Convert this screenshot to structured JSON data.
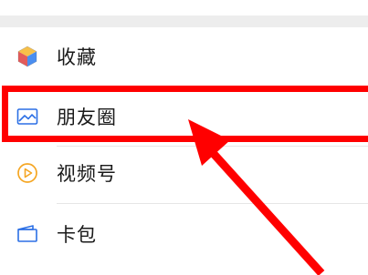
{
  "menu": {
    "items": [
      {
        "label": "收藏",
        "icon": "favorites-cube-icon"
      },
      {
        "label": "朋友圈",
        "icon": "moments-picture-icon"
      },
      {
        "label": "视频号",
        "icon": "channels-play-icon"
      },
      {
        "label": "卡包",
        "icon": "card-wallet-icon"
      }
    ]
  },
  "annotation": {
    "color": "#ff0000",
    "highlighted_item": "朋友圈"
  },
  "colors": {
    "moments_icon": "#2b6fe5",
    "channels_icon": "#f5a623",
    "card_icon": "#2b6fe5",
    "background_band": "#ededed"
  }
}
